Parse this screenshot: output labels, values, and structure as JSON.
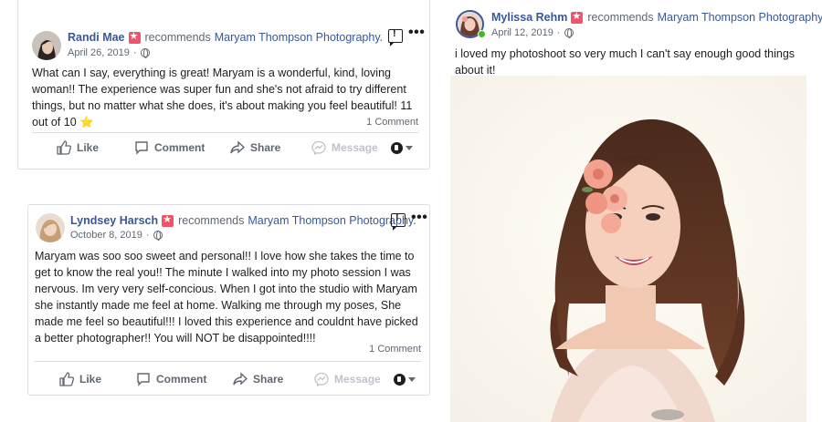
{
  "posts": [
    {
      "author": "Randi Mae",
      "action_text": "recommends",
      "page": "Maryam Thompson Photography.",
      "date": "April 26, 2019",
      "body": "What can I say, everything is great! Maryam is a wonderful, kind, loving woman!! The experience was super fun and she's not afraid to try different things, but no matter what she does, it's about making you feel beautiful! 11 out of 10 ⭐",
      "comments": "1 Comment",
      "actions": [
        "Like",
        "Comment",
        "Share",
        "Message"
      ]
    },
    {
      "author": "Lyndsey Harsch",
      "action_text": "recommends",
      "page": "Maryam Thompson Photography.",
      "date": "October 8, 2019",
      "body": "Maryam was soo soo sweet and personal!! I love how she takes the time to get to know the real you!! The minute I walked into my photo session I was nervous. Im very very self-concious. When I got into the studio with Maryam she instantly made me feel at home. Walking me through my poses, She made me feel so beautiful!!! I loved this experience and couldnt have picked a better photographer!! You will NOT be disappointed!!!!",
      "comments": "1 Comment",
      "actions": [
        "Like",
        "Comment",
        "Share",
        "Message"
      ]
    },
    {
      "author": "Mylissa Rehm",
      "action_text": "recommends",
      "page": "Maryam Thompson Photography.",
      "date": "April 12, 2019",
      "body": "i loved my photoshoot so very much I can't say enough good things about it!"
    }
  ],
  "separator": "·",
  "colors": {
    "link": "#385898",
    "badge": "#f35369",
    "muted": "#606770",
    "online": "#42b72a"
  },
  "icons": [
    "rec-badge-icon",
    "globe-icon",
    "message-icon",
    "more-icon",
    "like-icon",
    "comment-icon",
    "share-icon",
    "messenger-icon",
    "audience-icon",
    "caret-down-icon"
  ]
}
